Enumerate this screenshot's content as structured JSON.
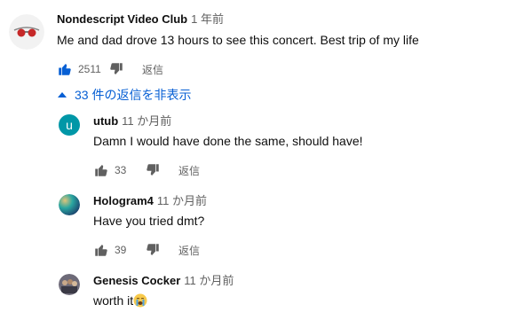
{
  "top_comment": {
    "author": "Nondescript Video Club",
    "time": "1 年前",
    "text": "Me and dad drove 13 hours to see this concert. Best trip of my life",
    "likes": "2511",
    "reply_label": "返信"
  },
  "replies_toggle": {
    "label": "33 件の返信を非表示"
  },
  "replies": [
    {
      "author": "utub",
      "time": "11 か月前",
      "text": "Damn I would have done the same, should have!",
      "likes": "33",
      "reply_label": "返信",
      "avatar_letter": "u",
      "avatar_color": "#0097a7"
    },
    {
      "author": "Hologram4",
      "time": "11 か月前",
      "text": "Have you tried dmt?",
      "likes": "39",
      "reply_label": "返信"
    },
    {
      "author": "Genesis Cocker",
      "time": "11 か月前",
      "text": "worth it"
    }
  ],
  "colors": {
    "link_blue": "#065fd4",
    "liked_blue": "#065fd4",
    "muted": "#606060"
  }
}
